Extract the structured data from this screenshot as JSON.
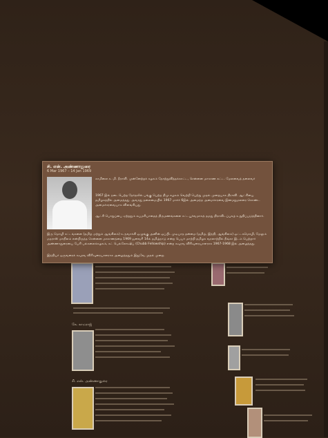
{
  "popup": {
    "name": "சி. என். அண்ணாதுரை",
    "dates": "6 Mar 1967 – 14 Jan 1969",
    "para1": "காமிலை க. மி. தீராவி. முன்னேற்றக் கழகம் தோற்றுவித்தக்காட்ட, சென்னை மாகாண கட்ட. மேலவைத் தலைவர்",
    "para2": "1967 இல் நடைபெற்ற தேர்தலில் பங்கு பெற்ற திமு கழகம் வெற்றி பெற்று முதல் முறையாக திராவி. ஆட்சியை தமிழகத்தில் அமைத்தது. அவரது தலைமையில் 1967 மார்ச் 6இல் அமைந்த அமைச்சரவை இனமறுமலரை கொண்ட அமைச்சரவையாக விளங்கியது.",
    "para3": "ஆட்சி பொறுப்பை ஏற்றதும் சுயமரியாதைத் திருமணங்களை சட்டபூர்வமாகத் தமது திராவிடப்புகழ் உறுதிப்படுத்தினார்.",
    "para4": "இரு மொழி சட்டங்களை (தமிழ் மற்றும் ஆங்கிலம்) உருவாக்கி ஒழுங்கு அனின் ஒப்பிடமுடியாத தன்மை (தமிழ், இந்தி, ஆங்கிலம்) ஒட்டகமொழி, மேலும் மதராஸ் மாநிலம் என்றிருந்த சென்னை மாகாணத்தை 1969 ஜனவரி 14ல் தமிழ்நாடு என்ற பெயர் மாற்றி தமிழக வரலாற்றில் நீங்கா இடம் பெற்றார் அண்ணாதுரையை பேசி பல்கலைக்கழகம், கட் பெல்லோஷிப் (Chubb Fellowship) என்ற கவுரவ விரிவுரையாளராக 1967-1968 இல் அழைத்தது.",
    "para5": "இந்தியர் ஒருவரைக் கவுரவ விரிவுரையாளராக அழைத்ததும் இதுவே முதல் முறை."
  },
  "background": {
    "left_col": [
      {
        "title": ""
      },
      {
        "title": "கே. காமராஜ்"
      },
      {
        "title": "சி. என். அண்ணாதுரை"
      }
    ],
    "right_col": [
      {
        "title": ""
      },
      {
        "title": ""
      },
      {
        "title": ""
      }
    ]
  },
  "colors": {
    "background": "#332519",
    "popup": "#785640",
    "text": "#f4ebdd"
  }
}
